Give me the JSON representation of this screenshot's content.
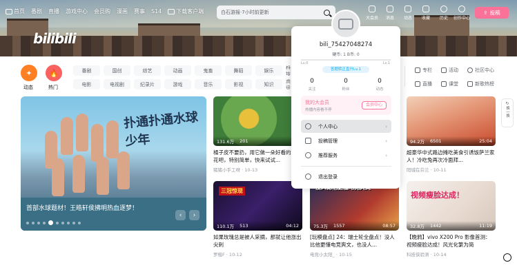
{
  "nav": {
    "left": [
      "首页",
      "番剧",
      "直播",
      "游戏中心",
      "会员购",
      "漫画",
      "赛事",
      "S14",
      "下载客户端"
    ],
    "search_placeholder": "白石游报·7小时前更新",
    "right": [
      "大会员",
      "消息",
      "动态",
      "收藏",
      "历史",
      "创作中心"
    ],
    "upload": "投稿"
  },
  "logo": "bilibili",
  "bigicons": [
    {
      "label": "动态",
      "color": "#ff7f24"
    },
    {
      "label": "热门",
      "color": "#f9625f"
    }
  ],
  "chips_row1": [
    "番剧",
    "国创",
    "综艺",
    "动画",
    "鬼畜",
    "舞蹈",
    "娱乐",
    "科技"
  ],
  "chips_row2": [
    "电影",
    "电视剧",
    "纪录片",
    "游戏",
    "音乐",
    "影视",
    "知识",
    "资讯"
  ],
  "side_cats": [
    "专栏",
    "活动",
    "社区中心",
    "直播",
    "课堂",
    "新歌热榜"
  ],
  "carousel": {
    "caption": "首部水球题材！王皓轩侯拂明热血逐梦！",
    "art_title": "扑通扑通水球少年"
  },
  "cards": [
    {
      "views": "131.6万",
      "comments": "201",
      "duration": "",
      "title": "橘子皮不要扔，用它做一朵好看的玫瑰花吧，特别简单，快来试试...",
      "author": "猪猪小手工呀 · 10-13"
    },
    {
      "views": "94.2万",
      "comments": "6501",
      "duration": "25:04",
      "title": "超豪华中式路边摊吃美食引诱饭萨兰家人！冷吃兔再次冷面拜...",
      "author": "阳城在芬兰 · 10-11"
    },
    {
      "views": "110.1万",
      "comments": "513",
      "duration": "04:12",
      "title": "如果玫瑰总是被人采摘，那就让他涨出尖刺",
      "author": "罗楷F · 10-12"
    },
    {
      "views": "75.3万",
      "comments": "1557",
      "duration": "08:57",
      "title": "[玩模盘点] 24：瑞士轮全盘点！没人比他更懂电竞爽文，也没人...",
      "author": "电竞小太阳_ · 10-15"
    },
    {
      "views": "32.8万",
      "comments": "1442",
      "duration": "11:19",
      "title": "【晚鸦】vivo X200 Pro 影像首测：视频瘦脸达成！风光化繁为简",
      "author": "科技侠验测 · 10-14"
    }
  ],
  "card3_overlay": "三冠惊现",
  "card4_overlay": "没人比他更懂电竞爽文",
  "card5_overlay": "视频瘦脸达成！",
  "profile": {
    "username": "bili_75427048274",
    "coins": "硬币: 1    B币: 0",
    "lv_left": "Lv.0",
    "lv_right": "Lv.1",
    "level_tag": "答题转正直升Lv.1",
    "stats": [
      {
        "n": "0",
        "l": "关注"
      },
      {
        "n": "0",
        "l": "粉丝"
      },
      {
        "n": "0",
        "l": "动态"
      }
    ],
    "vip_title": "我的大会员",
    "vip_sub": "热播内容看不停",
    "vip_btn": "会员中心",
    "menu": [
      "个人中心",
      "投稿管理",
      "推荐服务"
    ],
    "logout": "退出登录"
  },
  "side_btn": "换一换"
}
